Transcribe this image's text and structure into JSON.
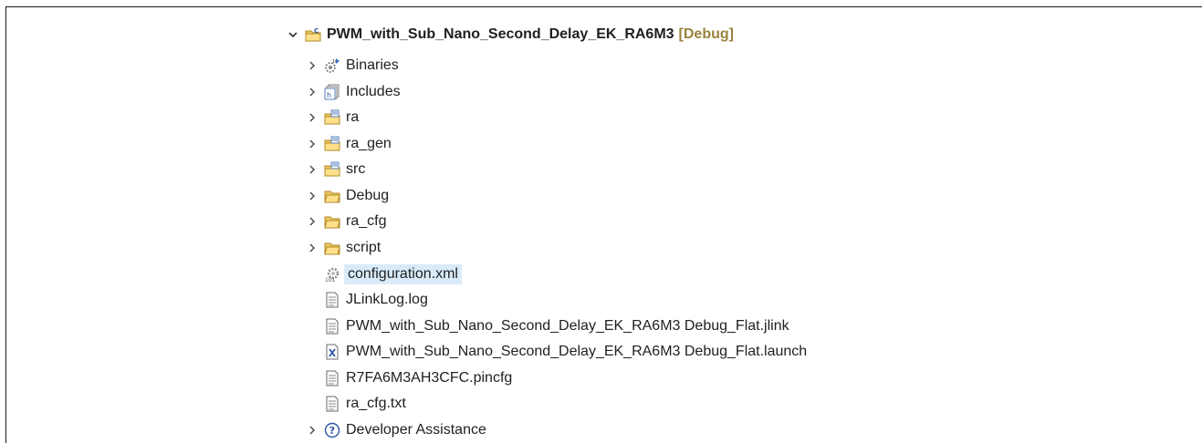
{
  "tree": {
    "project": {
      "label": "PWM_with_Sub_Nano_Second_Delay_EK_RA6M3",
      "decoration": "[Debug]",
      "icon": "c-project-folder-icon"
    },
    "items": [
      {
        "label": "Binaries",
        "icon": "binaries-icon",
        "expandable": true
      },
      {
        "label": "Includes",
        "icon": "includes-icon",
        "expandable": true
      },
      {
        "label": "ra",
        "icon": "source-folder-icon",
        "expandable": true
      },
      {
        "label": "ra_gen",
        "icon": "source-folder-icon",
        "expandable": true
      },
      {
        "label": "src",
        "icon": "source-folder-icon",
        "expandable": true
      },
      {
        "label": "Debug",
        "icon": "folder-icon",
        "expandable": true
      },
      {
        "label": "ra_cfg",
        "icon": "folder-icon",
        "expandable": true
      },
      {
        "label": "script",
        "icon": "folder-icon",
        "expandable": true
      },
      {
        "label": "configuration.xml",
        "icon": "configuration-gear-icon",
        "expandable": false,
        "selected": true
      },
      {
        "label": "JLinkLog.log",
        "icon": "text-file-icon",
        "expandable": false
      },
      {
        "label": "PWM_with_Sub_Nano_Second_Delay_EK_RA6M3 Debug_Flat.jlink",
        "icon": "text-file-icon",
        "expandable": false
      },
      {
        "label": "PWM_with_Sub_Nano_Second_Delay_EK_RA6M3 Debug_Flat.launch",
        "icon": "launch-file-icon",
        "expandable": false
      },
      {
        "label": "R7FA6M3AH3CFC.pincfg",
        "icon": "text-file-icon",
        "expandable": false
      },
      {
        "label": "ra_cfg.txt",
        "icon": "text-file-icon",
        "expandable": false
      },
      {
        "label": "Developer Assistance",
        "icon": "help-icon",
        "expandable": true
      }
    ]
  },
  "colors": {
    "selection": "#d9ebf9",
    "decoration": "#9c8240",
    "folder": "#e8b64c",
    "source_folder_badge": "#5a7fc0"
  }
}
